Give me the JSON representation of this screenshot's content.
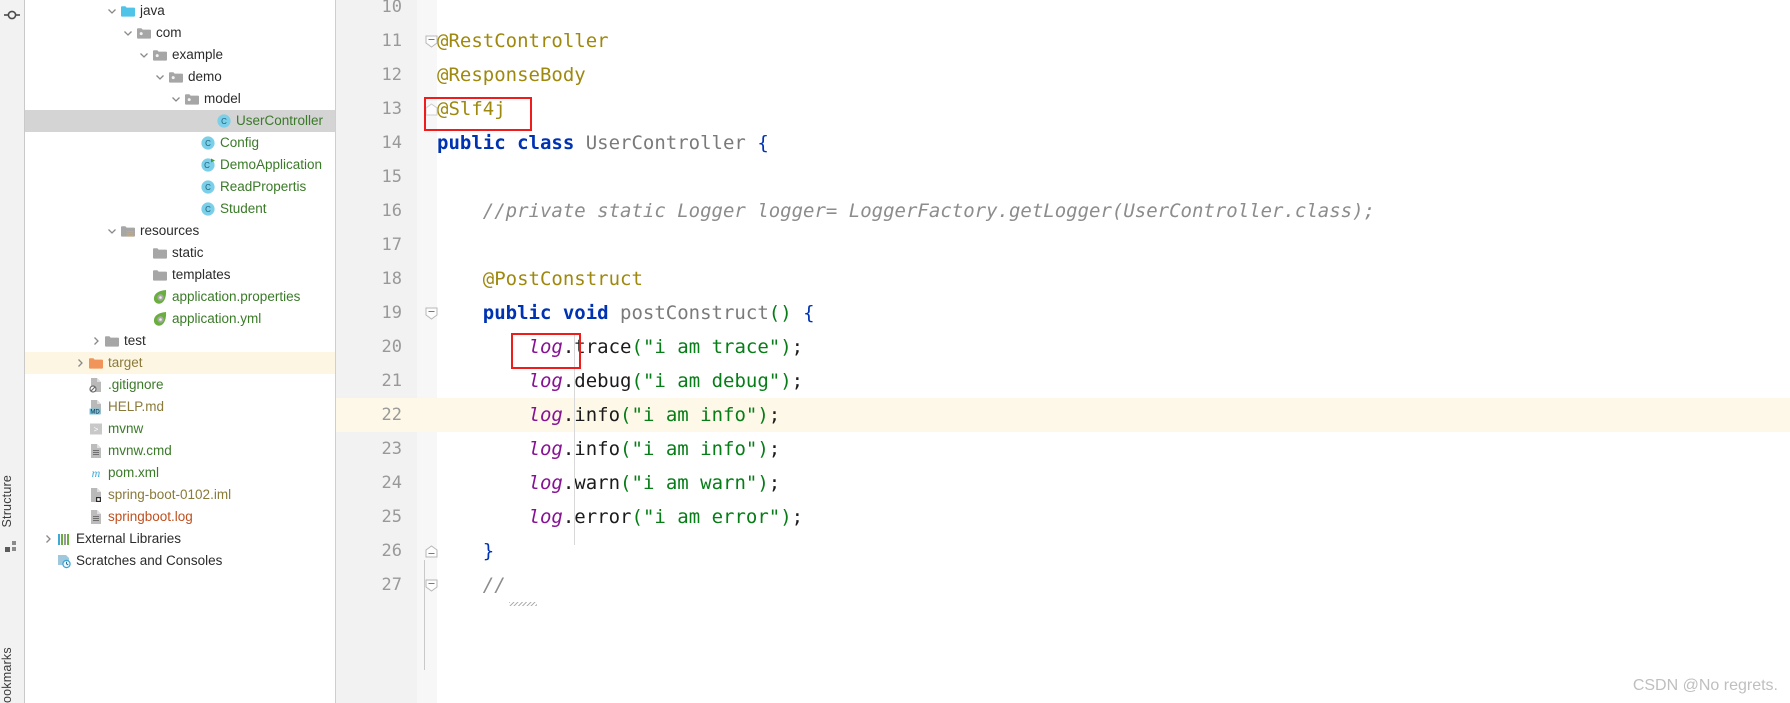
{
  "app": {
    "name": "IntelliJ IDEA Project View with Java Editor",
    "watermark": "CSDN @No regrets."
  },
  "toolstrip": {
    "icons": [
      "locate-target-icon",
      "structure-panel-icon",
      "bookmarks-panel-icon"
    ],
    "labels": {
      "structure": "Structure",
      "bookmarks": "ookmarks"
    }
  },
  "tree": {
    "items": [
      {
        "label": "java",
        "indent": 5,
        "icon": "folder-source-icon",
        "arrow": "chevron-down",
        "color": "#2b2b2b",
        "state": "normal"
      },
      {
        "label": "com",
        "indent": 6,
        "icon": "folder-package-icon",
        "arrow": "chevron-down",
        "color": "#2b2b2b",
        "state": "normal"
      },
      {
        "label": "example",
        "indent": 7,
        "icon": "folder-package-icon",
        "arrow": "chevron-down",
        "color": "#2b2b2b",
        "state": "normal"
      },
      {
        "label": "demo",
        "indent": 8,
        "icon": "folder-package-icon",
        "arrow": "chevron-down",
        "color": "#2b2b2b",
        "state": "normal"
      },
      {
        "label": "model",
        "indent": 9,
        "icon": "folder-package-icon",
        "arrow": "chevron-down",
        "color": "#2b2b2b",
        "state": "normal"
      },
      {
        "label": "UserController",
        "indent": 11,
        "icon": "java-class-icon",
        "arrow": "none",
        "color": "#3a7a28",
        "state": "selected"
      },
      {
        "label": "Config",
        "indent": 10,
        "icon": "java-class-icon",
        "arrow": "none",
        "color": "#3a7a28",
        "state": "normal"
      },
      {
        "label": "DemoApplication",
        "indent": 10,
        "icon": "java-runnable-class-icon",
        "arrow": "none",
        "color": "#3a7a28",
        "state": "normal"
      },
      {
        "label": "ReadPropertis",
        "indent": 10,
        "icon": "java-class-icon",
        "arrow": "none",
        "color": "#3a7a28",
        "state": "normal"
      },
      {
        "label": "Student",
        "indent": 10,
        "icon": "java-class-icon",
        "arrow": "none",
        "color": "#3a7a28",
        "state": "normal"
      },
      {
        "label": "resources",
        "indent": 5,
        "icon": "folder-resources-icon",
        "arrow": "chevron-down",
        "color": "#2b2b2b",
        "state": "normal"
      },
      {
        "label": "static",
        "indent": 7,
        "icon": "folder-icon",
        "arrow": "none",
        "color": "#2b2b2b",
        "state": "normal"
      },
      {
        "label": "templates",
        "indent": 7,
        "icon": "folder-icon",
        "arrow": "none",
        "color": "#2b2b2b",
        "state": "normal"
      },
      {
        "label": "application.properties",
        "indent": 7,
        "icon": "spring-leaf-icon",
        "arrow": "none",
        "color": "#3a7a28",
        "state": "normal"
      },
      {
        "label": "application.yml",
        "indent": 7,
        "icon": "spring-leaf-icon",
        "arrow": "none",
        "color": "#3a7a28",
        "state": "normal"
      },
      {
        "label": "test",
        "indent": 4,
        "icon": "folder-icon",
        "arrow": "chevron-right",
        "color": "#2b2b2b",
        "state": "normal"
      },
      {
        "label": "target",
        "indent": 3,
        "icon": "folder-excluded-icon",
        "arrow": "chevron-right",
        "color": "#8a7a3a",
        "state": "highlight"
      },
      {
        "label": ".gitignore",
        "indent": 3,
        "icon": "gitignore-file-icon",
        "arrow": "none",
        "color": "#3a7a28",
        "state": "normal"
      },
      {
        "label": "HELP.md",
        "indent": 3,
        "icon": "markdown-file-icon",
        "arrow": "none",
        "color": "#8a7a3a",
        "state": "normal"
      },
      {
        "label": "mvnw",
        "indent": 3,
        "icon": "script-file-icon",
        "arrow": "none",
        "color": "#3a7a28",
        "state": "normal"
      },
      {
        "label": "mvnw.cmd",
        "indent": 3,
        "icon": "text-file-icon",
        "arrow": "none",
        "color": "#3a7a28",
        "state": "normal"
      },
      {
        "label": "pom.xml",
        "indent": 3,
        "icon": "maven-file-icon",
        "arrow": "none",
        "color": "#3a7a28",
        "state": "normal"
      },
      {
        "label": "spring-boot-0102.iml",
        "indent": 3,
        "icon": "module-file-icon",
        "arrow": "none",
        "color": "#8a7a3a",
        "state": "normal"
      },
      {
        "label": "springboot.log",
        "indent": 3,
        "icon": "text-file-icon",
        "arrow": "none",
        "color": "#c0501e",
        "state": "normal"
      },
      {
        "label": "External Libraries",
        "indent": 1,
        "icon": "libraries-icon",
        "arrow": "chevron-right",
        "color": "#2b2b2b",
        "state": "normal"
      },
      {
        "label": "Scratches and Consoles",
        "indent": 1,
        "icon": "scratches-icon",
        "arrow": "none",
        "color": "#2b2b2b",
        "state": "normal"
      }
    ]
  },
  "editor": {
    "lines": [
      {
        "num": "10",
        "fold": "none",
        "indent": 0,
        "tokens": []
      },
      {
        "num": "11",
        "fold": "collapse-start",
        "indent": 0,
        "tokens": [
          {
            "t": "@RestController",
            "c": "anno"
          }
        ]
      },
      {
        "num": "12",
        "fold": "none",
        "indent": 0,
        "tokens": [
          {
            "t": "@ResponseBody",
            "c": "anno"
          }
        ]
      },
      {
        "num": "13",
        "fold": "collapse-end-up",
        "indent": 0,
        "tokens": [
          {
            "t": "@Slf4j",
            "c": "anno"
          }
        ]
      },
      {
        "num": "14",
        "fold": "none",
        "indent": 0,
        "tokens": [
          {
            "t": "public ",
            "c": "k"
          },
          {
            "t": "class ",
            "c": "k"
          },
          {
            "t": "UserController ",
            "c": "cls"
          },
          {
            "t": "{",
            "c": "brc"
          }
        ]
      },
      {
        "num": "15",
        "fold": "none",
        "indent": 0,
        "tokens": []
      },
      {
        "num": "16",
        "fold": "none",
        "indent": 0,
        "tokens": [
          {
            "t": "    //private static Logger logger= LoggerFactory.getLogger(UserController.class);",
            "c": "cmt"
          }
        ]
      },
      {
        "num": "17",
        "fold": "none",
        "indent": 0,
        "tokens": []
      },
      {
        "num": "18",
        "fold": "none",
        "indent": 0,
        "tokens": [
          {
            "t": "    @PostConstruct",
            "c": "anno"
          }
        ]
      },
      {
        "num": "19",
        "fold": "collapse-start",
        "indent": 0,
        "tokens": [
          {
            "t": "    ",
            "c": "pl"
          },
          {
            "t": "public ",
            "c": "k"
          },
          {
            "t": "void ",
            "c": "k"
          },
          {
            "t": "postConstruct",
            "c": "cls"
          },
          {
            "t": "()",
            "c": "par"
          },
          {
            "t": " ",
            "c": "pl"
          },
          {
            "t": "{",
            "c": "brc"
          }
        ]
      },
      {
        "num": "20",
        "fold": "none",
        "indent": 0,
        "tokens": [
          {
            "t": "        ",
            "c": "pl"
          },
          {
            "t": "log",
            "c": "fld"
          },
          {
            "t": ".trace",
            "c": "pl"
          },
          {
            "t": "(",
            "c": "par"
          },
          {
            "t": "\"i am trace\"",
            "c": "str"
          },
          {
            "t": ")",
            "c": "par"
          },
          {
            "t": ";",
            "c": "pl"
          }
        ]
      },
      {
        "num": "21",
        "fold": "none",
        "indent": 0,
        "tokens": [
          {
            "t": "        ",
            "c": "pl"
          },
          {
            "t": "log",
            "c": "fld"
          },
          {
            "t": ".debug",
            "c": "pl"
          },
          {
            "t": "(",
            "c": "par"
          },
          {
            "t": "\"i am debug\"",
            "c": "str"
          },
          {
            "t": ")",
            "c": "par"
          },
          {
            "t": ";",
            "c": "pl"
          }
        ]
      },
      {
        "num": "22",
        "fold": "none",
        "indent": 0,
        "tokens": [
          {
            "t": "        ",
            "c": "pl"
          },
          {
            "t": "log",
            "c": "fld"
          },
          {
            "t": ".info",
            "c": "pl"
          },
          {
            "t": "(",
            "c": "par"
          },
          {
            "t": "\"i am info\"",
            "c": "str"
          },
          {
            "t": ")",
            "c": "par"
          },
          {
            "t": ";",
            "c": "pl"
          }
        ]
      },
      {
        "num": "23",
        "fold": "none",
        "indent": 0,
        "tokens": [
          {
            "t": "        ",
            "c": "pl"
          },
          {
            "t": "log",
            "c": "fld"
          },
          {
            "t": ".info",
            "c": "pl"
          },
          {
            "t": "(",
            "c": "par"
          },
          {
            "t": "\"i am info\"",
            "c": "str"
          },
          {
            "t": ")",
            "c": "par"
          },
          {
            "t": ";",
            "c": "pl"
          }
        ]
      },
      {
        "num": "24",
        "fold": "none",
        "indent": 0,
        "tokens": [
          {
            "t": "        ",
            "c": "pl"
          },
          {
            "t": "log",
            "c": "fld"
          },
          {
            "t": ".warn",
            "c": "pl"
          },
          {
            "t": "(",
            "c": "par"
          },
          {
            "t": "\"i am warn\"",
            "c": "str"
          },
          {
            "t": ")",
            "c": "par"
          },
          {
            "t": ";",
            "c": "pl"
          }
        ]
      },
      {
        "num": "25",
        "fold": "none",
        "indent": 0,
        "tokens": [
          {
            "t": "        ",
            "c": "pl"
          },
          {
            "t": "log",
            "c": "fld"
          },
          {
            "t": ".error",
            "c": "pl"
          },
          {
            "t": "(",
            "c": "par"
          },
          {
            "t": "\"i am error\"",
            "c": "str"
          },
          {
            "t": ")",
            "c": "par"
          },
          {
            "t": ";",
            "c": "pl"
          }
        ]
      },
      {
        "num": "26",
        "fold": "collapse-end",
        "indent": 0,
        "tokens": [
          {
            "t": "    ",
            "c": "pl"
          },
          {
            "t": "}",
            "c": "brc"
          }
        ]
      },
      {
        "num": "27",
        "fold": "collapse-start",
        "indent": 0,
        "tokens": [
          {
            "t": "    //",
            "c": "cmt"
          }
        ]
      }
    ],
    "highlighted_line": "22",
    "annotations": [
      {
        "name": "slf4j-annotation-highlight",
        "label": "@Slf4j"
      },
      {
        "name": "log-field-highlight",
        "label": "log"
      }
    ]
  }
}
